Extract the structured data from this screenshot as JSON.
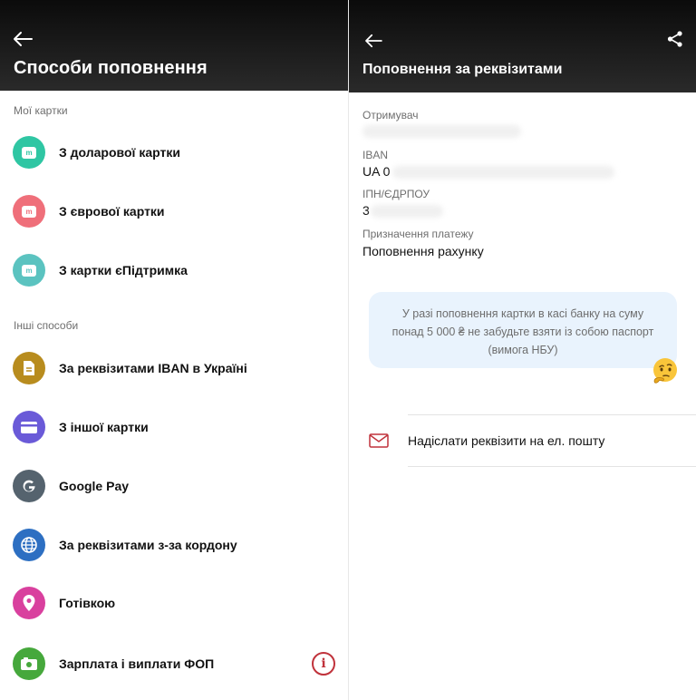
{
  "left": {
    "header": {
      "title": "Способи поповнення"
    },
    "my_cards": {
      "section_label": "Мої картки",
      "items": [
        {
          "label": "З доларової картки",
          "icon": "mono-card-icon",
          "badge": "m",
          "color": "#2fc6a3"
        },
        {
          "label": "З єврової картки",
          "icon": "mono-card-icon",
          "badge": "m",
          "color": "#ef6f7a"
        },
        {
          "label": "З картки єПідтримка",
          "icon": "mono-card-icon",
          "badge": "m",
          "color": "#5bc3c0"
        }
      ]
    },
    "other_methods": {
      "section_label": "Інші способи",
      "items": [
        {
          "label": "За реквізитами IBAN в Україні",
          "icon": "document-icon",
          "color": "#b88c1e"
        },
        {
          "label": "З іншої картки",
          "icon": "card-icon",
          "color": "#6a5ad8"
        },
        {
          "label": "Google Pay",
          "icon": "google-icon",
          "color": "#55636e"
        },
        {
          "label": "За реквізитами з-за кордону",
          "icon": "globe-icon",
          "color": "#2d6fc2"
        },
        {
          "label": "Готівкою",
          "icon": "location-pin-icon",
          "color": "#d9409e"
        },
        {
          "label": "Зарплата і виплати ФОП",
          "icon": "camera-icon",
          "color": "#46a83c"
        }
      ]
    },
    "info_symbol": "i"
  },
  "right": {
    "header": {
      "title": "Поповнення за реквізитами"
    },
    "recipient": {
      "label": "Отримувач"
    },
    "iban": {
      "label": "IBAN",
      "value": "UA 0"
    },
    "tax_id": {
      "label": "ІПН/ЄДРПОУ",
      "value": "3"
    },
    "purpose": {
      "label": "Призначення платежу",
      "value": "Поповнення рахунку"
    },
    "notice": "У разі поповнення картки в касі банку на суму понад 5 000 ₴ не забудьте взяти із собою паспорт (вимога НБУ)",
    "email_action": "Надіслати реквізити на ел. пошту",
    "colors": {
      "accent": "#c0323b",
      "notice_bg": "#e9f3fd"
    }
  }
}
